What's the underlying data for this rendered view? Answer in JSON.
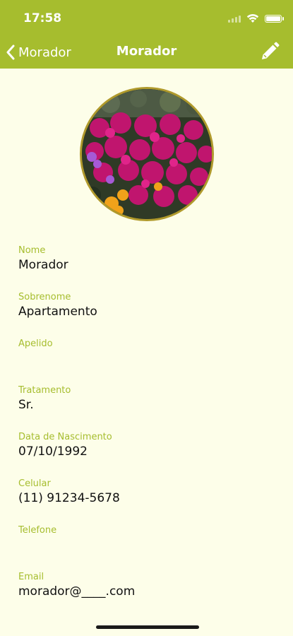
{
  "status_bar": {
    "time": "17:58"
  },
  "nav": {
    "back_label": "Morador",
    "title": "Morador"
  },
  "fields": [
    {
      "label": "Nome",
      "value": "Morador"
    },
    {
      "label": "Sobrenome",
      "value": "Apartamento"
    },
    {
      "label": "Apelido",
      "value": ""
    },
    {
      "label": "Tratamento",
      "value": "Sr."
    },
    {
      "label": "Data de Nascimento",
      "value": "07/10/1992"
    },
    {
      "label": "Celular",
      "value": "(11) 91234-5678"
    },
    {
      "label": "Telefone",
      "value": ""
    },
    {
      "label": "Email",
      "value": "morador@____.com"
    }
  ],
  "colors": {
    "accent": "#a6bd2e",
    "background": "#fdfee9",
    "avatar_border": "#b09a2c"
  },
  "icons": [
    "chevron-left-icon",
    "pencil-icon",
    "wifi-icon",
    "battery-icon"
  ]
}
